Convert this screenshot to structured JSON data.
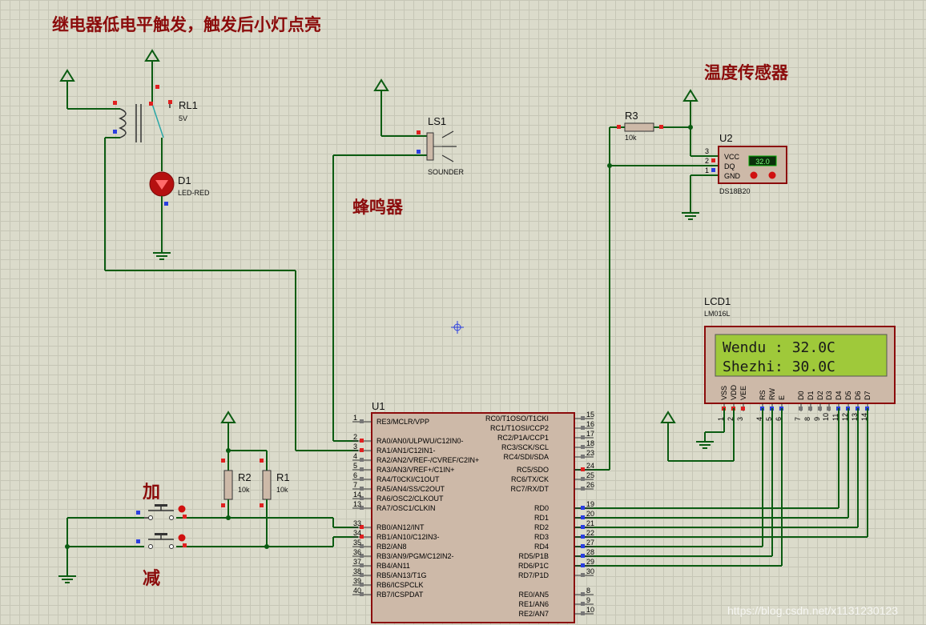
{
  "annotations": {
    "relay_title": "继电器低电平触发，触发后小灯点亮",
    "temp_sensor": "温度传感器",
    "buzzer": "蜂鸣器",
    "plus": "加",
    "minus": "减"
  },
  "components": {
    "relay": {
      "ref": "RL1",
      "value": "5V"
    },
    "led": {
      "ref": "D1",
      "value": "LED-RED"
    },
    "buzzer": {
      "ref": "LS1",
      "value": "SOUNDER"
    },
    "r3": {
      "ref": "R3",
      "value": "10k"
    },
    "sensor": {
      "ref": "U2",
      "value": "DS18B20",
      "reading": "32.0",
      "pins": [
        "VCC",
        "DQ",
        "GND"
      ],
      "pin_numbers": [
        "3",
        "2",
        "1"
      ]
    },
    "lcd": {
      "ref": "LCD1",
      "value": "LM016L",
      "line1": "Wendu : 32.0C",
      "line2": "Shezhi: 30.0C",
      "pins": [
        "VSS",
        "VDD",
        "VEE",
        "RS",
        "RW",
        "E",
        "D0",
        "D1",
        "D2",
        "D3",
        "D4",
        "D5",
        "D6",
        "D7"
      ],
      "pin_numbers": [
        "1",
        "2",
        "3",
        "4",
        "5",
        "6",
        "7",
        "8",
        "9",
        "10",
        "11",
        "12",
        "13",
        "14"
      ]
    },
    "r2": {
      "ref": "R2",
      "value": "10k"
    },
    "r1": {
      "ref": "R1",
      "value": "10k"
    },
    "mcu": {
      "ref": "U1",
      "left_pins": [
        {
          "num": "1",
          "name": "RE3/MCLR/VPP"
        },
        {
          "num": "2",
          "name": "RA0/AN0/ULPWU/C12IN0-"
        },
        {
          "num": "3",
          "name": "RA1/AN1/C12IN1-"
        },
        {
          "num": "4",
          "name": "RA2/AN2/VREF-/CVREF/C2IN+"
        },
        {
          "num": "5",
          "name": "RA3/AN3/VREF+/C1IN+"
        },
        {
          "num": "6",
          "name": "RA4/T0CKI/C1OUT"
        },
        {
          "num": "7",
          "name": "RA5/AN4/SS/C2OUT"
        },
        {
          "num": "14",
          "name": "RA6/OSC2/CLKOUT"
        },
        {
          "num": "13",
          "name": "RA7/OSC1/CLKIN"
        },
        {
          "num": "33",
          "name": "RB0/AN12/INT"
        },
        {
          "num": "34",
          "name": "RB1/AN10/C12IN3-"
        },
        {
          "num": "35",
          "name": "RB2/AN8"
        },
        {
          "num": "36",
          "name": "RB3/AN9/PGM/C12IN2-"
        },
        {
          "num": "37",
          "name": "RB4/AN11"
        },
        {
          "num": "38",
          "name": "RB5/AN13/T1G"
        },
        {
          "num": "39",
          "name": "RB6/ICSPCLK"
        },
        {
          "num": "40",
          "name": "RB7/ICSPDAT"
        }
      ],
      "right_pins": [
        {
          "num": "15",
          "name": "RC0/T1OSO/T1CKI"
        },
        {
          "num": "16",
          "name": "RC1/T1OSI/CCP2"
        },
        {
          "num": "17",
          "name": "RC2/P1A/CCP1"
        },
        {
          "num": "18",
          "name": "RC3/SCK/SCL"
        },
        {
          "num": "23",
          "name": "RC4/SDI/SDA"
        },
        {
          "num": "24",
          "name": "RC5/SDO"
        },
        {
          "num": "25",
          "name": "RC6/TX/CK"
        },
        {
          "num": "26",
          "name": "RC7/RX/DT"
        },
        {
          "num": "19",
          "name": "RD0"
        },
        {
          "num": "20",
          "name": "RD1"
        },
        {
          "num": "21",
          "name": "RD2"
        },
        {
          "num": "22",
          "name": "RD3"
        },
        {
          "num": "27",
          "name": "RD4"
        },
        {
          "num": "28",
          "name": "RD5/P1B"
        },
        {
          "num": "29",
          "name": "RD6/P1C"
        },
        {
          "num": "30",
          "name": "RD7/P1D"
        },
        {
          "num": "8",
          "name": "RE0/AN5"
        },
        {
          "num": "9",
          "name": "RE1/AN6"
        },
        {
          "num": "10",
          "name": "RE2/AN7"
        }
      ]
    }
  },
  "watermark": "https://blog.csdn.net/x1131230123",
  "colors": {
    "wire": "#0b5c12",
    "body": "#cdb9a8",
    "outline": "#8b0b0b",
    "annotation": "#8b0b0b"
  }
}
